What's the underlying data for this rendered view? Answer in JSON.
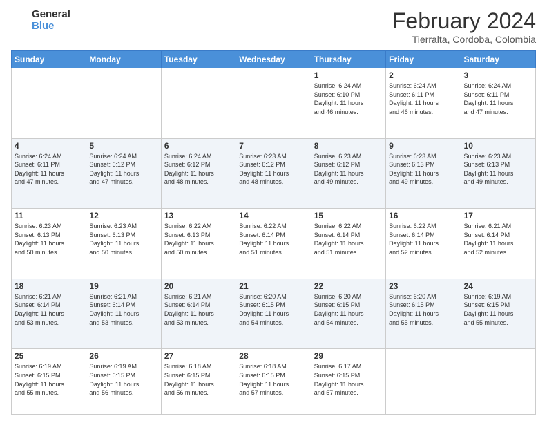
{
  "logo": {
    "line1": "General",
    "line2": "Blue"
  },
  "title": "February 2024",
  "subtitle": "Tierralta, Cordoba, Colombia",
  "headers": [
    "Sunday",
    "Monday",
    "Tuesday",
    "Wednesday",
    "Thursday",
    "Friday",
    "Saturday"
  ],
  "weeks": [
    [
      {
        "day": "",
        "info": ""
      },
      {
        "day": "",
        "info": ""
      },
      {
        "day": "",
        "info": ""
      },
      {
        "day": "",
        "info": ""
      },
      {
        "day": "1",
        "info": "Sunrise: 6:24 AM\nSunset: 6:10 PM\nDaylight: 11 hours\nand 46 minutes."
      },
      {
        "day": "2",
        "info": "Sunrise: 6:24 AM\nSunset: 6:11 PM\nDaylight: 11 hours\nand 46 minutes."
      },
      {
        "day": "3",
        "info": "Sunrise: 6:24 AM\nSunset: 6:11 PM\nDaylight: 11 hours\nand 47 minutes."
      }
    ],
    [
      {
        "day": "4",
        "info": "Sunrise: 6:24 AM\nSunset: 6:11 PM\nDaylight: 11 hours\nand 47 minutes."
      },
      {
        "day": "5",
        "info": "Sunrise: 6:24 AM\nSunset: 6:12 PM\nDaylight: 11 hours\nand 47 minutes."
      },
      {
        "day": "6",
        "info": "Sunrise: 6:24 AM\nSunset: 6:12 PM\nDaylight: 11 hours\nand 48 minutes."
      },
      {
        "day": "7",
        "info": "Sunrise: 6:23 AM\nSunset: 6:12 PM\nDaylight: 11 hours\nand 48 minutes."
      },
      {
        "day": "8",
        "info": "Sunrise: 6:23 AM\nSunset: 6:12 PM\nDaylight: 11 hours\nand 49 minutes."
      },
      {
        "day": "9",
        "info": "Sunrise: 6:23 AM\nSunset: 6:13 PM\nDaylight: 11 hours\nand 49 minutes."
      },
      {
        "day": "10",
        "info": "Sunrise: 6:23 AM\nSunset: 6:13 PM\nDaylight: 11 hours\nand 49 minutes."
      }
    ],
    [
      {
        "day": "11",
        "info": "Sunrise: 6:23 AM\nSunset: 6:13 PM\nDaylight: 11 hours\nand 50 minutes."
      },
      {
        "day": "12",
        "info": "Sunrise: 6:23 AM\nSunset: 6:13 PM\nDaylight: 11 hours\nand 50 minutes."
      },
      {
        "day": "13",
        "info": "Sunrise: 6:22 AM\nSunset: 6:13 PM\nDaylight: 11 hours\nand 50 minutes."
      },
      {
        "day": "14",
        "info": "Sunrise: 6:22 AM\nSunset: 6:14 PM\nDaylight: 11 hours\nand 51 minutes."
      },
      {
        "day": "15",
        "info": "Sunrise: 6:22 AM\nSunset: 6:14 PM\nDaylight: 11 hours\nand 51 minutes."
      },
      {
        "day": "16",
        "info": "Sunrise: 6:22 AM\nSunset: 6:14 PM\nDaylight: 11 hours\nand 52 minutes."
      },
      {
        "day": "17",
        "info": "Sunrise: 6:21 AM\nSunset: 6:14 PM\nDaylight: 11 hours\nand 52 minutes."
      }
    ],
    [
      {
        "day": "18",
        "info": "Sunrise: 6:21 AM\nSunset: 6:14 PM\nDaylight: 11 hours\nand 53 minutes."
      },
      {
        "day": "19",
        "info": "Sunrise: 6:21 AM\nSunset: 6:14 PM\nDaylight: 11 hours\nand 53 minutes."
      },
      {
        "day": "20",
        "info": "Sunrise: 6:21 AM\nSunset: 6:14 PM\nDaylight: 11 hours\nand 53 minutes."
      },
      {
        "day": "21",
        "info": "Sunrise: 6:20 AM\nSunset: 6:15 PM\nDaylight: 11 hours\nand 54 minutes."
      },
      {
        "day": "22",
        "info": "Sunrise: 6:20 AM\nSunset: 6:15 PM\nDaylight: 11 hours\nand 54 minutes."
      },
      {
        "day": "23",
        "info": "Sunrise: 6:20 AM\nSunset: 6:15 PM\nDaylight: 11 hours\nand 55 minutes."
      },
      {
        "day": "24",
        "info": "Sunrise: 6:19 AM\nSunset: 6:15 PM\nDaylight: 11 hours\nand 55 minutes."
      }
    ],
    [
      {
        "day": "25",
        "info": "Sunrise: 6:19 AM\nSunset: 6:15 PM\nDaylight: 11 hours\nand 55 minutes."
      },
      {
        "day": "26",
        "info": "Sunrise: 6:19 AM\nSunset: 6:15 PM\nDaylight: 11 hours\nand 56 minutes."
      },
      {
        "day": "27",
        "info": "Sunrise: 6:18 AM\nSunset: 6:15 PM\nDaylight: 11 hours\nand 56 minutes."
      },
      {
        "day": "28",
        "info": "Sunrise: 6:18 AM\nSunset: 6:15 PM\nDaylight: 11 hours\nand 57 minutes."
      },
      {
        "day": "29",
        "info": "Sunrise: 6:17 AM\nSunset: 6:15 PM\nDaylight: 11 hours\nand 57 minutes."
      },
      {
        "day": "",
        "info": ""
      },
      {
        "day": "",
        "info": ""
      }
    ]
  ]
}
